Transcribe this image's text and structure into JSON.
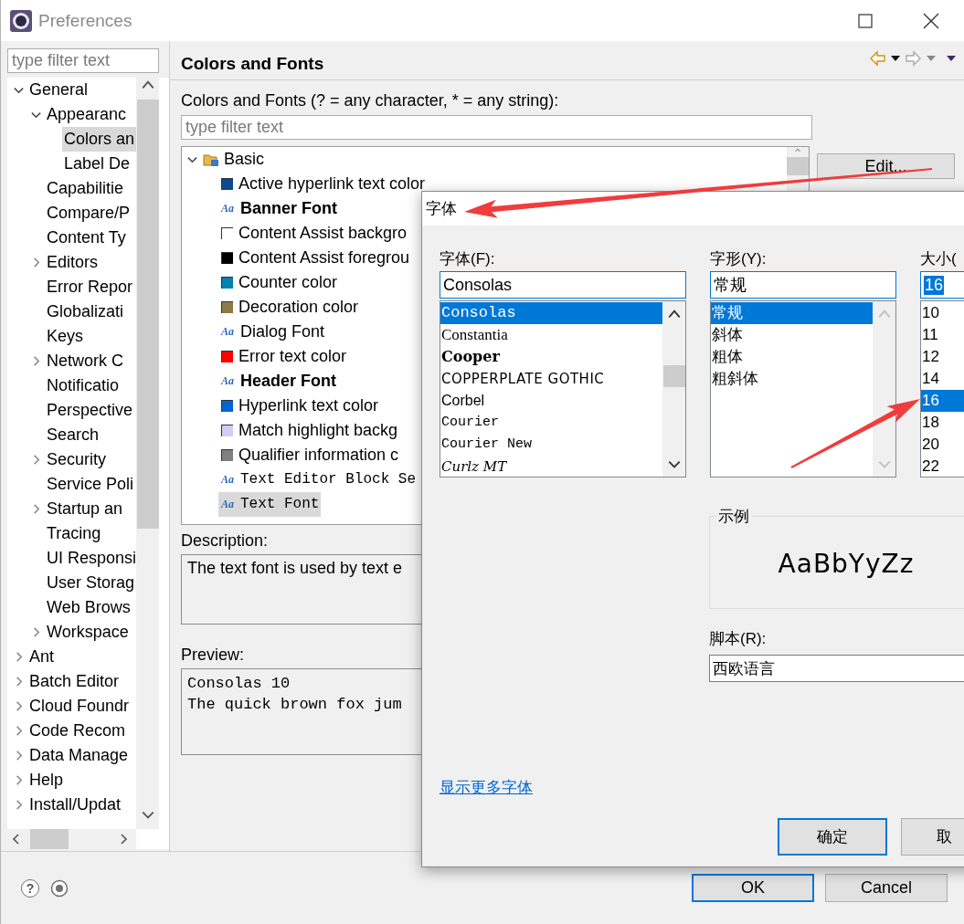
{
  "window": {
    "title": "Preferences"
  },
  "sidebar": {
    "filter_placeholder": "type filter text",
    "items": [
      {
        "label": "General",
        "expanded": true,
        "selected": false,
        "children": [
          {
            "label": "Appearanc",
            "expanded": true,
            "selected": false,
            "children": [
              {
                "label": "Colors an",
                "selected": true
              },
              {
                "label": "Label De",
                "selected": false
              }
            ]
          },
          {
            "label": "Capabilitie",
            "selected": false
          },
          {
            "label": "Compare/P",
            "selected": false
          },
          {
            "label": "Content Ty",
            "selected": false
          },
          {
            "label": "Editors",
            "expanded": false,
            "selected": false
          },
          {
            "label": "Error Repor",
            "selected": false
          },
          {
            "label": "Globalizati",
            "selected": false
          },
          {
            "label": "Keys",
            "selected": false
          },
          {
            "label": "Network C",
            "expanded": false,
            "selected": false
          },
          {
            "label": "Notificatio",
            "selected": false
          },
          {
            "label": "Perspective",
            "selected": false
          },
          {
            "label": "Search",
            "selected": false
          },
          {
            "label": "Security",
            "expanded": false,
            "selected": false
          },
          {
            "label": "Service Poli",
            "selected": false
          },
          {
            "label": "Startup an",
            "expanded": false,
            "selected": false
          },
          {
            "label": "Tracing",
            "selected": false
          },
          {
            "label": "UI Responsi",
            "selected": false
          },
          {
            "label": "User Storag",
            "selected": false
          },
          {
            "label": "Web Brows",
            "selected": false
          },
          {
            "label": "Workspace",
            "expanded": false,
            "selected": false
          }
        ]
      },
      {
        "label": "Ant",
        "expanded": false,
        "selected": false
      },
      {
        "label": "Batch Editor",
        "expanded": false,
        "selected": false
      },
      {
        "label": "Cloud Foundr",
        "expanded": false,
        "selected": false
      },
      {
        "label": "Code Recom",
        "expanded": false,
        "selected": false
      },
      {
        "label": "Data Manage",
        "expanded": false,
        "selected": false
      },
      {
        "label": "Help",
        "expanded": false,
        "selected": false
      },
      {
        "label": "Install/Updat",
        "expanded": false,
        "selected": false
      }
    ]
  },
  "page": {
    "title": "Colors and Fonts",
    "filter_label": "Colors and Fonts (? = any character, * = any string):",
    "filter_placeholder": "type filter text",
    "tree": [
      {
        "label": "Basic",
        "expanded": true,
        "children": [
          {
            "kind": "color",
            "label": "Active hyperlink text color",
            "color": "#0b4a91",
            "selected": false
          },
          {
            "kind": "font",
            "icon": "Aa",
            "label": "Banner Font",
            "bold": true,
            "monospace": false,
            "selected": false
          },
          {
            "kind": "color",
            "label": "Content Assist backgro",
            "color": "#ffffff",
            "selected": false
          },
          {
            "kind": "color",
            "label": "Content Assist foregrou",
            "color": "#000000",
            "selected": false
          },
          {
            "kind": "color",
            "label": "Counter color",
            "color": "#0082b0",
            "selected": false
          },
          {
            "kind": "color",
            "label": "Decoration color",
            "color": "#8c7b48",
            "selected": false
          },
          {
            "kind": "font",
            "icon": "Aa",
            "label": "Dialog Font",
            "bold": false,
            "monospace": false,
            "selected": false
          },
          {
            "kind": "color",
            "label": "Error text color",
            "color": "#ff0000",
            "selected": false
          },
          {
            "kind": "font",
            "icon": "Aa",
            "label": "Header Font",
            "bold": true,
            "monospace": false,
            "selected": false
          },
          {
            "kind": "color",
            "label": "Hyperlink text color",
            "color": "#0064d2",
            "selected": false
          },
          {
            "kind": "color",
            "label": "Match highlight backg",
            "color": "#d2cdf5",
            "selected": false
          },
          {
            "kind": "color",
            "label": "Qualifier information c",
            "color": "#808080",
            "selected": false
          },
          {
            "kind": "font",
            "icon": "Aa",
            "label": "Text Editor Block Se",
            "bold": false,
            "monospace": true,
            "selected": false
          },
          {
            "kind": "font",
            "icon": "Aa",
            "label": "Text Font",
            "bold": false,
            "monospace": true,
            "selected": true
          }
        ]
      }
    ],
    "edit_button": "Edit...",
    "description_label": "Description:",
    "description": "The text font is used by text e",
    "preview_label": "Preview:",
    "preview": [
      "Consolas 10",
      "The quick brown fox jum"
    ]
  },
  "help": "?",
  "buttons": [
    {
      "label": "OK",
      "default": true
    },
    {
      "label": "Cancel",
      "default": false
    }
  ],
  "font_dialog": {
    "title": "字体",
    "columns": [
      {
        "label": "字体(F):",
        "value": "Consolas",
        "value_highlighted": false,
        "scrollbar_disabled": false,
        "options": [
          {
            "label": "Consolas",
            "kind": "mono",
            "selected": true
          },
          {
            "label": "Constantia",
            "kind": "serif",
            "selected": false
          },
          {
            "label": "Cooper",
            "kind": "black",
            "selected": false
          },
          {
            "label": "COPPERPLATE GOTHIC",
            "kind": "caps",
            "selected": false
          },
          {
            "label": "Corbel",
            "kind": "sans",
            "selected": false
          },
          {
            "label": "Courier",
            "kind": "typewriter",
            "selected": false
          },
          {
            "label": "Courier New",
            "kind": "typewriter",
            "selected": false
          },
          {
            "label": "Curlz MT",
            "kind": "script",
            "selected": false
          }
        ]
      },
      {
        "label": "字形(Y):",
        "value": "常规",
        "value_highlighted": false,
        "scrollbar_disabled": true,
        "options": [
          {
            "label": "常规",
            "kind": "plain",
            "selected": true
          },
          {
            "label": "斜体",
            "kind": "plain",
            "selected": false
          },
          {
            "label": "粗体",
            "kind": "plain",
            "selected": false
          },
          {
            "label": "粗斜体",
            "kind": "plain",
            "selected": false
          }
        ]
      },
      {
        "label": "大小(",
        "value": "16",
        "value_highlighted": true,
        "options": [
          {
            "label": "10",
            "kind": "plain",
            "selected": false
          },
          {
            "label": "11",
            "kind": "plain",
            "selected": false
          },
          {
            "label": "12",
            "kind": "plain",
            "selected": false
          },
          {
            "label": "14",
            "kind": "plain",
            "selected": false
          },
          {
            "label": "16",
            "kind": "plain",
            "selected": true
          },
          {
            "label": "18",
            "kind": "plain",
            "selected": false
          },
          {
            "label": "20",
            "kind": "plain",
            "selected": false
          },
          {
            "label": "22",
            "kind": "plain",
            "selected": false
          }
        ]
      }
    ],
    "sample": {
      "label": "示例",
      "text": "AaBbYyZz"
    },
    "script": {
      "label": "脚本(R):",
      "value": "西欧语言"
    },
    "more_fonts_link": "显示更多字体",
    "buttons": [
      {
        "label": "确定",
        "default": true
      },
      {
        "label": "取",
        "default": false
      }
    ]
  },
  "annotations": [
    {
      "kind": "arrow"
    },
    {
      "kind": "arrow"
    }
  ]
}
